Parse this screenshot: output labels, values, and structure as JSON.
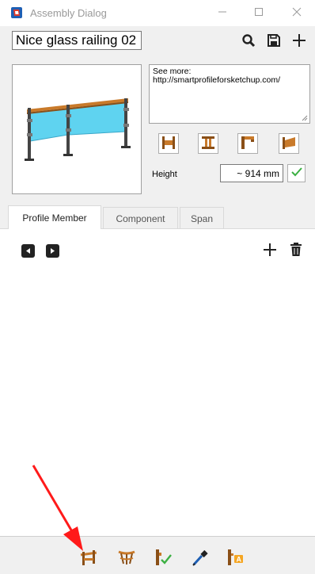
{
  "window": {
    "title": "Assembly Dialog",
    "icons": {
      "app": "sketchup-icon",
      "minimize": "minimize-icon",
      "maximize": "maximize-icon",
      "close": "close-icon"
    }
  },
  "header": {
    "assembly_name": "Nice glass railing 02",
    "icons": {
      "search": "search-icon",
      "save": "save-icon",
      "add": "plus-icon"
    }
  },
  "description": {
    "line1": "See more:",
    "line2": "http://smartprofileforsketchup.com/"
  },
  "shape_buttons": [
    "profile-ends-icon",
    "profile-i-icon",
    "profile-corner-icon",
    "profile-angle-icon"
  ],
  "height": {
    "label": "Height",
    "value": "~ 914 mm",
    "apply_icon": "checkmark-icon"
  },
  "tabs": [
    {
      "label": "Profile Member",
      "active": true
    },
    {
      "label": "Component",
      "active": false
    },
    {
      "label": "Span",
      "active": false
    }
  ],
  "content_toolbar": {
    "icons": {
      "prev": "previous-icon",
      "next": "next-icon",
      "add": "plus-icon",
      "delete": "trash-icon"
    }
  },
  "bottom_toolbar": [
    "railing-tool-icon",
    "curved-railing-icon",
    "profile-check-icon",
    "eyedropper-icon",
    "profile-label-icon"
  ],
  "colors": {
    "accent_wood": "#c97a2a",
    "glass": "#5fd3f0",
    "check_green": "#3cb043",
    "annotation_arrow": "#ff1a1a"
  }
}
